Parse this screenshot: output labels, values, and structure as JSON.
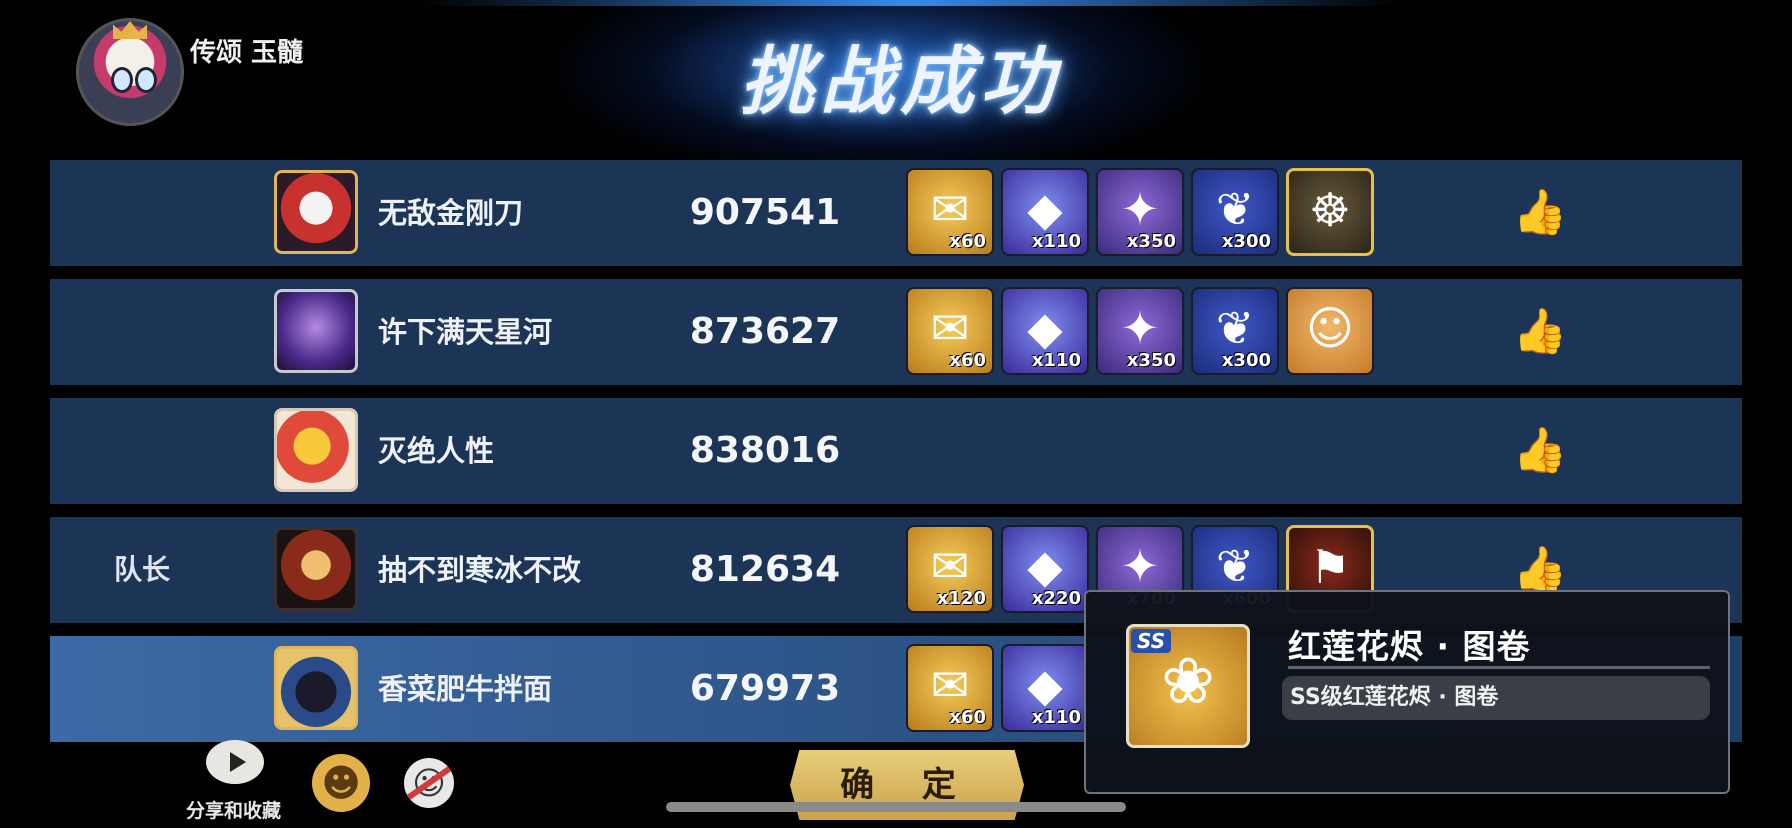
{
  "player": {
    "name": "传颂 玉髓"
  },
  "banner": {
    "title": "挑战成功"
  },
  "rows": [
    {
      "role": "",
      "hero_icon": "hero-masked-warrior-icon",
      "name": "无敌金刚刀",
      "score": "907541",
      "items": [
        {
          "icon": "gold-scroll-icon",
          "qty": "x60"
        },
        {
          "icon": "blue-crystal-icon",
          "qty": "x110"
        },
        {
          "icon": "star-shard-icon",
          "qty": "x350"
        },
        {
          "icon": "jade-bundle-icon",
          "qty": "x300"
        },
        {
          "icon": "lantern-treasure-icon",
          "qty": ""
        }
      ]
    },
    {
      "role": "",
      "hero_icon": "hero-shadow-dancer-icon",
      "name": "许下满天星河",
      "score": "873627",
      "items": [
        {
          "icon": "gold-scroll-icon",
          "qty": "x60"
        },
        {
          "icon": "blue-crystal-icon",
          "qty": "x110"
        },
        {
          "icon": "star-shard-icon",
          "qty": "x350"
        },
        {
          "icon": "jade-bundle-icon",
          "qty": "x300"
        },
        {
          "icon": "spirit-scroll-icon",
          "qty": ""
        }
      ]
    },
    {
      "role": "",
      "hero_icon": "hero-sleepy-star-icon",
      "name": "灭绝人性",
      "score": "838016",
      "items": []
    },
    {
      "role": "队长",
      "hero_icon": "hero-golden-general-icon",
      "name": "抽不到寒冰不改",
      "score": "812634",
      "items": [
        {
          "icon": "gold-scroll-icon",
          "qty": "x120"
        },
        {
          "icon": "blue-crystal-icon",
          "qty": "x220"
        },
        {
          "icon": "star-shard-icon",
          "qty": "x700"
        },
        {
          "icon": "jade-bundle-icon",
          "qty": "x600"
        },
        {
          "icon": "banner-treasure-icon",
          "qty": ""
        }
      ]
    },
    {
      "role": "",
      "hero_icon": "hero-witch-cat-icon",
      "name": "香菜肥牛拌面",
      "score": "679973",
      "items": [
        {
          "icon": "gold-scroll-icon",
          "qty": "x60"
        },
        {
          "icon": "blue-crystal-icon",
          "qty": "x110"
        }
      ]
    }
  ],
  "bottom": {
    "share_label": "分享和收藏",
    "confirm_label": "确 定"
  },
  "tooltip": {
    "grade": "SS",
    "title": "红莲花烬 · 图卷",
    "description": "SS级红莲花烬 · 图卷"
  },
  "colors": {
    "row_bg": "#1c3556",
    "row_selected_bg": "#3d6aa6",
    "accent_gold": "#e6c14a",
    "confirm_bg": "#e9cf7a"
  }
}
